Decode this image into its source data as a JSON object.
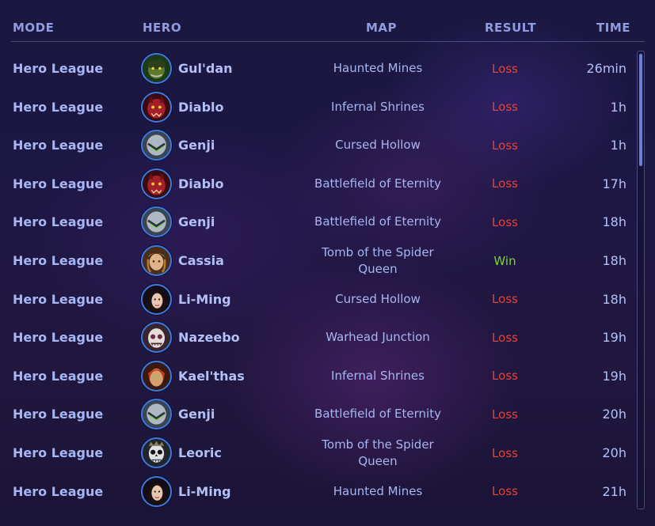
{
  "columns": {
    "mode": "MODE",
    "hero": "HERO",
    "map": "MAP",
    "result": "RESULT",
    "time": "TIME"
  },
  "rows": [
    {
      "mode": "Hero League",
      "hero": "Gul'dan",
      "icon": "guldan-portrait-icon",
      "map": "Haunted Mines",
      "result": "Loss",
      "time": "26min"
    },
    {
      "mode": "Hero League",
      "hero": "Diablo",
      "icon": "diablo-portrait-icon",
      "map": "Infernal Shrines",
      "result": "Loss",
      "time": "1h"
    },
    {
      "mode": "Hero League",
      "hero": "Genji",
      "icon": "genji-portrait-icon",
      "map": "Cursed Hollow",
      "result": "Loss",
      "time": "1h"
    },
    {
      "mode": "Hero League",
      "hero": "Diablo",
      "icon": "diablo-portrait-icon",
      "map": "Battlefield of Eternity",
      "result": "Loss",
      "time": "17h"
    },
    {
      "mode": "Hero League",
      "hero": "Genji",
      "icon": "genji-portrait-icon",
      "map": "Battlefield of Eternity",
      "result": "Loss",
      "time": "18h"
    },
    {
      "mode": "Hero League",
      "hero": "Cassia",
      "icon": "cassia-portrait-icon",
      "map": "Tomb of the Spider Queen",
      "result": "Win",
      "time": "18h"
    },
    {
      "mode": "Hero League",
      "hero": "Li-Ming",
      "icon": "liming-portrait-icon",
      "map": "Cursed Hollow",
      "result": "Loss",
      "time": "18h"
    },
    {
      "mode": "Hero League",
      "hero": "Nazeebo",
      "icon": "nazeebo-portrait-icon",
      "map": "Warhead Junction",
      "result": "Loss",
      "time": "19h"
    },
    {
      "mode": "Hero League",
      "hero": "Kael'thas",
      "icon": "kaelthas-portrait-icon",
      "map": "Infernal Shrines",
      "result": "Loss",
      "time": "19h"
    },
    {
      "mode": "Hero League",
      "hero": "Genji",
      "icon": "genji-portrait-icon",
      "map": "Battlefield of Eternity",
      "result": "Loss",
      "time": "20h"
    },
    {
      "mode": "Hero League",
      "hero": "Leoric",
      "icon": "leoric-portrait-icon",
      "map": "Tomb of the Spider Queen",
      "result": "Loss",
      "time": "20h"
    },
    {
      "mode": "Hero League",
      "hero": "Li-Ming",
      "icon": "liming-portrait-icon",
      "map": "Haunted Mines",
      "result": "Loss",
      "time": "21h"
    }
  ],
  "colors": {
    "loss": "#e0453a",
    "win": "#7dd13a",
    "header": "#8f9ce0",
    "text": "#b3c0f7",
    "portrait_border": "#3d7be0"
  },
  "scrollbar": {
    "position_fraction": 0.0,
    "visible_fraction": 0.25
  }
}
